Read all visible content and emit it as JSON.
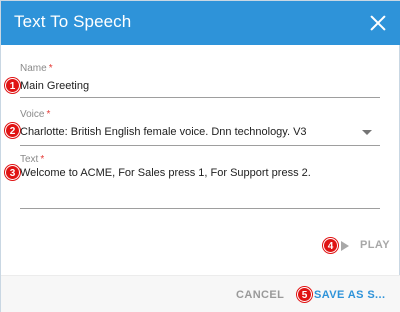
{
  "dialog": {
    "title": "Text To Speech"
  },
  "fields": {
    "name": {
      "label": "Name",
      "required_mark": "*",
      "value": "Main Greeting"
    },
    "voice": {
      "label": "Voice",
      "required_mark": "*",
      "value": "Charlotte: British English female voice. Dnn technology. V3"
    },
    "text": {
      "label": "Text",
      "required_mark": "*",
      "value": "Welcome to ACME, For Sales press 1, For Support press 2."
    }
  },
  "actions": {
    "play_label": "PLAY",
    "cancel_label": "CANCEL",
    "save_label": "SAVE AS S..."
  },
  "badges": [
    "1",
    "2",
    "3",
    "4",
    "5"
  ],
  "colors": {
    "header": "#2e93d9",
    "badge": "#e01414",
    "accent": "#2e93d9",
    "required": "#e53935"
  },
  "icons": {
    "close": "close-icon",
    "dropdown": "chevron-down-icon",
    "play": "play-icon"
  }
}
